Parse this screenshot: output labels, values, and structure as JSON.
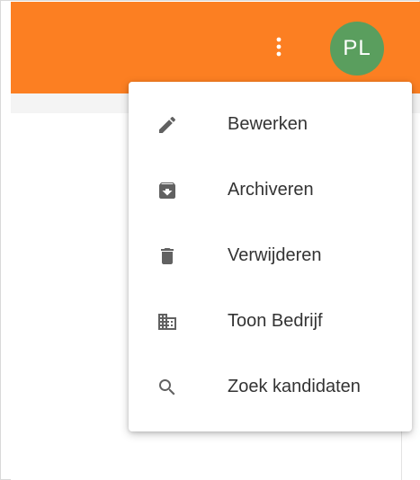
{
  "toolbar": {
    "background": "#fc7f22",
    "more_icon": "more-vert-icon"
  },
  "avatar": {
    "initials": "PL",
    "color": "#5a9e5e"
  },
  "menu": {
    "items": [
      {
        "label": "Bewerken",
        "icon": "edit-icon"
      },
      {
        "label": "Archiveren",
        "icon": "archive-icon"
      },
      {
        "label": "Verwijderen",
        "icon": "delete-icon"
      },
      {
        "label": "Toon Bedrijf",
        "icon": "business-icon"
      },
      {
        "label": "Zoek kandidaten",
        "icon": "search-icon"
      }
    ]
  }
}
